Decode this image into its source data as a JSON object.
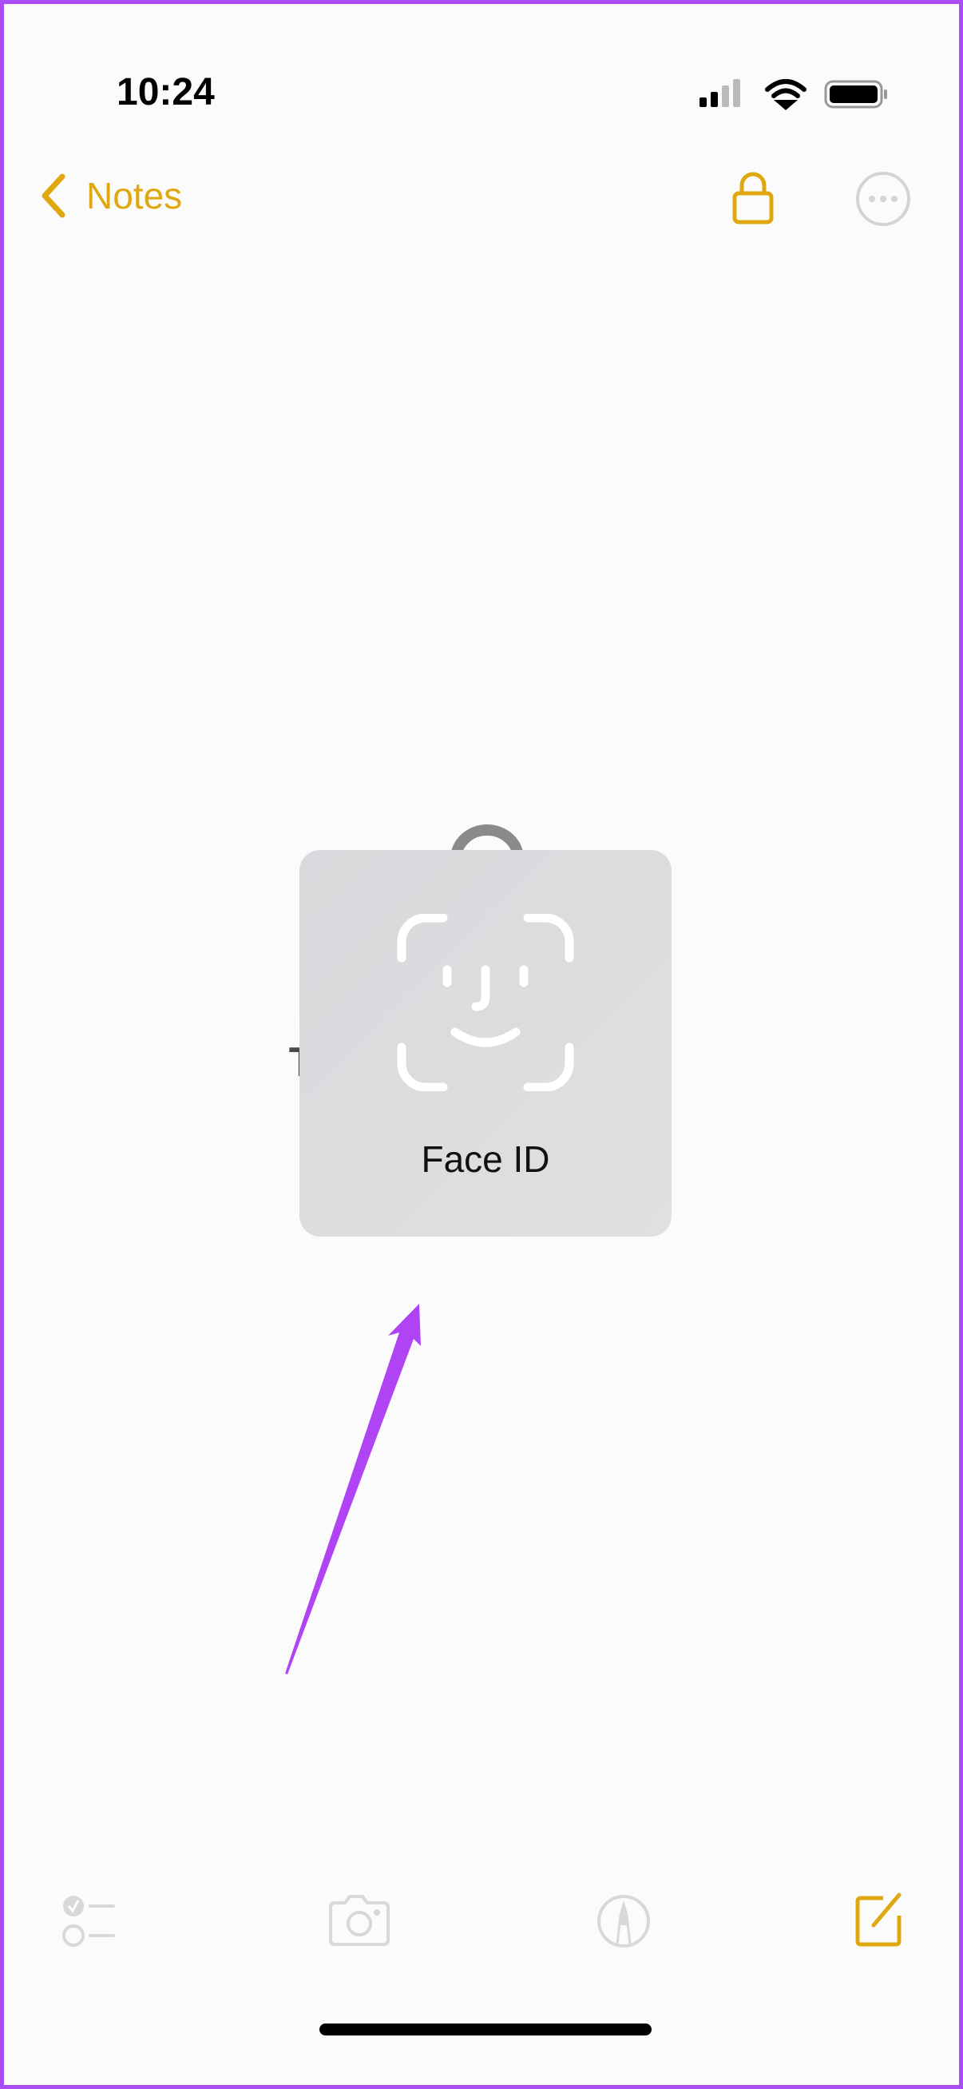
{
  "status_bar": {
    "time": "10:24",
    "signal_icon": "cellular-signal-icon",
    "wifi_icon": "wifi-icon",
    "battery_icon": "battery-icon"
  },
  "nav": {
    "back_label": "Notes",
    "accent_color": "#e0a810",
    "lock_icon": "lock-icon",
    "more_icon": "ellipsis-circle-icon"
  },
  "body": {
    "locked_message": "This note is locked."
  },
  "face_id": {
    "label": "Face ID",
    "icon": "face-id-icon"
  },
  "toolbar": {
    "items": [
      "checklist-icon",
      "camera-icon",
      "markup-icon",
      "compose-icon"
    ]
  },
  "annotation": {
    "arrow_color": "#b044f5"
  }
}
